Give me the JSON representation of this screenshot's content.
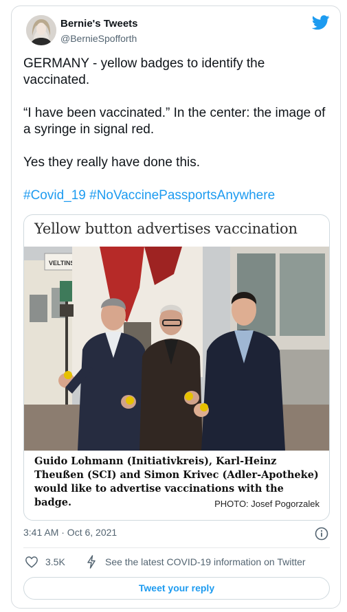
{
  "author": {
    "name": "Bernie's Tweets",
    "handle": "@BernieSpofforth"
  },
  "tweet": {
    "paragraphs": [
      "GERMANY - yellow badges to identify the vaccinated.",
      " “I have been vaccinated.” In the center: the image of a syringe in signal red.",
      "Yes they really have done this."
    ],
    "hashtags": [
      "#Covid_19",
      "#NoVaccinePassportsAnywhere"
    ]
  },
  "media": {
    "headline": "Yellow button advertises vaccination",
    "caption": "Guido Lohmann (Initiativkreis), Karl-Heinz Theußen (SCI) and Simon Krivec (Adler-Apotheke) would like to advertise vaccinations with the badge.",
    "credit": "PHOTO: Josef Pogorzalek",
    "photo_signs": [
      "VELTINS"
    ]
  },
  "meta": {
    "timestamp": "3:41 AM · Oct 6, 2021",
    "likes": "3.5K",
    "covid_link": "See the latest COVID-19 information on Twitter"
  },
  "reply": {
    "label": "Tweet your reply"
  },
  "colors": {
    "accent": "#1d9bf0",
    "text": "#0f1419",
    "muted": "#536471",
    "border": "#cfd9de"
  },
  "icons": [
    "twitter-bird-icon",
    "info-icon",
    "heart-icon",
    "covid-bolt-icon"
  ]
}
